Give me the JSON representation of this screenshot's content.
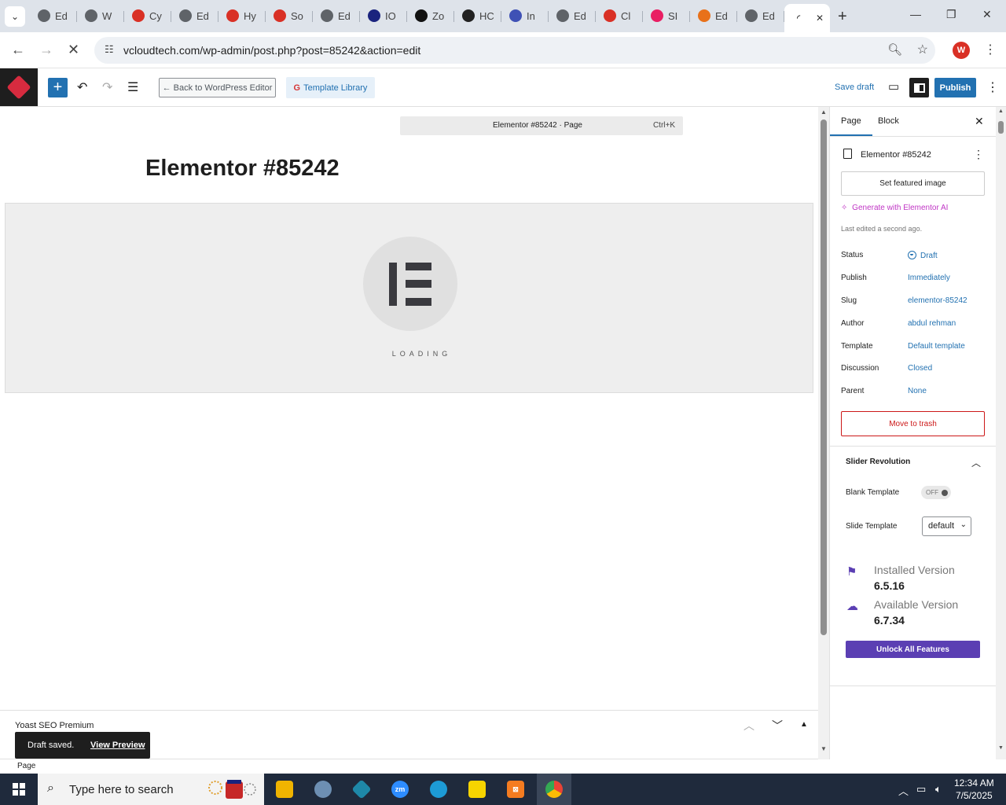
{
  "browser": {
    "tabs": [
      {
        "label": "Ed",
        "icon": "globe-icon",
        "color": "#5f6368"
      },
      {
        "label": "W",
        "icon": "globe-icon",
        "color": "#5f6368"
      },
      {
        "label": "Cy",
        "icon": "tag-icon",
        "color": "#d93025"
      },
      {
        "label": "Ed",
        "icon": "globe-icon",
        "color": "#5f6368"
      },
      {
        "label": "Hy",
        "icon": "tag-icon",
        "color": "#d93025"
      },
      {
        "label": "So",
        "icon": "tag-icon",
        "color": "#d93025"
      },
      {
        "label": "Ed",
        "icon": "globe-icon",
        "color": "#5f6368"
      },
      {
        "label": "IO",
        "icon": "slash-icon",
        "color": "#1a237e"
      },
      {
        "label": "Zo",
        "icon": "z-icon",
        "color": "#111111"
      },
      {
        "label": "HC",
        "icon": "circle-icon",
        "color": "#222222"
      },
      {
        "label": "In",
        "icon": "wave-icon",
        "color": "#3f51b5"
      },
      {
        "label": "Ed",
        "icon": "globe-icon",
        "color": "#5f6368"
      },
      {
        "label": "Cl",
        "icon": "pen-icon",
        "color": "#d93025"
      },
      {
        "label": "SI",
        "icon": "ring-icon",
        "color": "#e91e63"
      },
      {
        "label": "Ed",
        "icon": "grid-icon",
        "color": "#e8711a"
      },
      {
        "label": "Ed",
        "icon": "globe-icon",
        "color": "#5f6368"
      }
    ],
    "url": "vcloudtech.com/wp-admin/post.php?post=85242&action=edit",
    "profile_initial": "W"
  },
  "toolbar": {
    "back_label": "← Back to WordPress Editor",
    "template_label": "Template Library",
    "save_draft": "Save draft",
    "publish": "Publish"
  },
  "canvas": {
    "command_bar": "Elementor #85242 · Page",
    "command_shortcut": "Ctrl+K",
    "title": "Elementor #85242",
    "loading": "LOADING"
  },
  "yoast": {
    "label": "Yoast SEO Premium"
  },
  "snackbar": {
    "message": "Draft saved.",
    "link": "View Preview"
  },
  "footer": {
    "breadcrumb": "Page"
  },
  "sidebar": {
    "tab_page": "Page",
    "tab_block": "Block",
    "doc_title": "Elementor #85242",
    "featured_image": "Set featured image",
    "generate_ai": "Generate with Elementor AI",
    "last_edited": "Last edited a second ago.",
    "props": [
      {
        "label": "Status",
        "value": "Draft"
      },
      {
        "label": "Publish",
        "value": "Immediately"
      },
      {
        "label": "Slug",
        "value": "elementor-85242"
      },
      {
        "label": "Author",
        "value": "abdul rehman"
      },
      {
        "label": "Template",
        "value": "Default template"
      },
      {
        "label": "Discussion",
        "value": "Closed"
      },
      {
        "label": "Parent",
        "value": "None"
      }
    ],
    "trash": "Move to trash",
    "slider_panel": {
      "title": "Slider Revolution",
      "blank_template": "Blank Template",
      "toggle": "OFF",
      "slide_template": "Slide Template",
      "slide_value": "default",
      "installed_label": "Installed Version",
      "installed_version": "6.5.16",
      "available_label": "Available Version",
      "available_version": "6.7.34",
      "unlock": "Unlock All Features"
    }
  },
  "taskbar": {
    "search_placeholder": "Type here to search",
    "time": "12:34 AM",
    "date": "7/5/2025"
  }
}
